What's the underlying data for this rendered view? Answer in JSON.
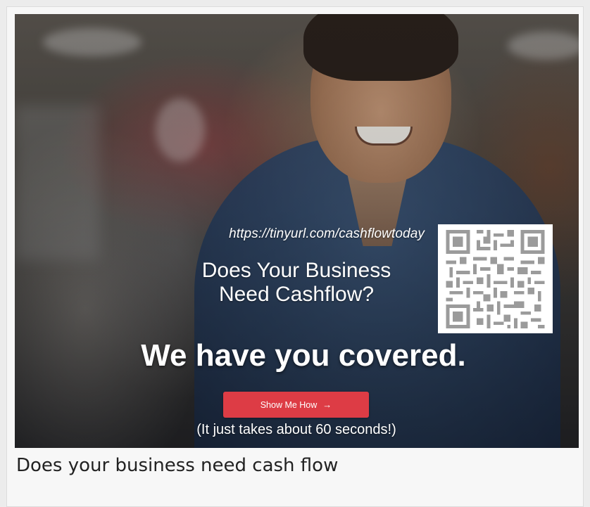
{
  "hero": {
    "url": "https://tinyurl.com/cashflowtoday",
    "headline_line1": "Does Your Business",
    "headline_line2": "Need Cashflow?",
    "tagline": "We have you covered.",
    "cta_label": "Show Me How",
    "cta_arrow": "→",
    "note": "(It just takes about 60 seconds!)",
    "accent_color": "#dd3c45"
  },
  "caption": "Does your business need cash flow"
}
